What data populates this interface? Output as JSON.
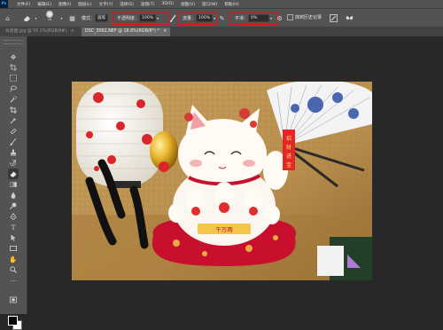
{
  "app": {
    "logo": "Ps"
  },
  "menu": [
    "文件(F)",
    "编辑(E)",
    "图像(I)",
    "图层(L)",
    "文字(Y)",
    "选择(S)",
    "滤镜(T)",
    "3D(D)",
    "视图(V)",
    "窗口(W)",
    "帮助(H)"
  ],
  "options": {
    "brush_size": "19",
    "mode_label": "模式：",
    "mode_value": "画笔",
    "opacity_label": "不透明度：",
    "opacity_value": "100%",
    "flow_label": "流量：",
    "flow_value": "100%",
    "smooth_label": "平滑：",
    "smooth_value": "0%",
    "history_label": "抹到历史记录"
  },
  "tabs": [
    {
      "label": "背景图.jpg @ 55.1%(RGB/8#)",
      "active": false
    },
    {
      "label": "DSC_3062.NEF @ 18.8%(RGB/8*) *",
      "active": true
    }
  ],
  "tools": [
    "move-tool",
    "artboard-tool",
    "marquee-tool",
    "lasso-tool",
    "quick-select-tool",
    "crop-tool",
    "eyedropper-tool",
    "healing-brush-tool",
    "brush-tool",
    "clone-stamp-tool",
    "history-brush-tool",
    "eraser-tool",
    "gradient-tool",
    "blur-tool",
    "dodge-tool",
    "pen-tool",
    "type-tool",
    "path-select-tool",
    "rectangle-tool",
    "hand-tool",
    "zoom-tool",
    "more-tools"
  ],
  "colors": {
    "foreground": "#000000",
    "background": "#ffffff",
    "highlight": "#ee1111"
  },
  "photo": {
    "lucky_charm_text": "招财进宝",
    "coin_text": "千万两"
  }
}
